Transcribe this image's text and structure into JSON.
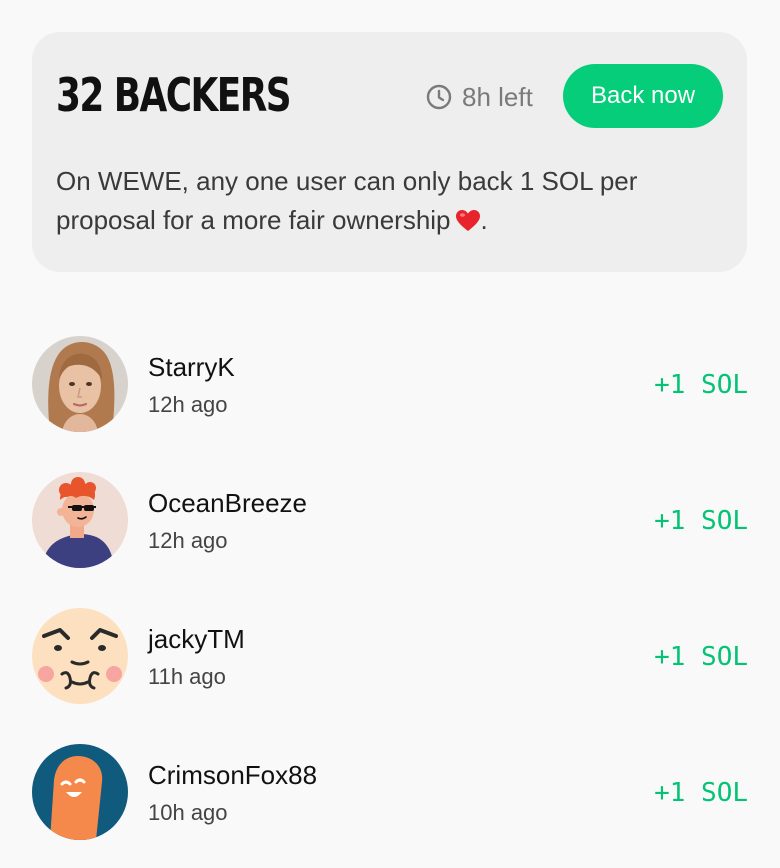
{
  "card": {
    "title": "32 BACKERS",
    "time_left": "8h left",
    "back_button": "Back now",
    "description": "On WEWE, any one user can only back 1 SOL per proposal for a more fair ownership",
    "description_end": ".",
    "heart_icon": "red-heart-emoji",
    "clock_icon": "clock-icon"
  },
  "colors": {
    "accent": "#05cd79",
    "amount": "#05c374",
    "card_bg": "#eeeeee",
    "page_bg": "#f9f9f9"
  },
  "backers": [
    {
      "name": "StarryK",
      "time": "12h ago",
      "amount": "+1 SOL",
      "avatar": "photo-woman-avatar"
    },
    {
      "name": "OceanBreeze",
      "time": "12h ago",
      "amount": "+1 SOL",
      "avatar": "cartoon-redhead-sunglasses-avatar"
    },
    {
      "name": "jackyTM",
      "time": "11h ago",
      "amount": "+1 SOL",
      "avatar": "smug-face-avatar"
    },
    {
      "name": "CrimsonFox88",
      "time": "10h ago",
      "amount": "+1 SOL",
      "avatar": "orange-blob-avatar"
    }
  ]
}
